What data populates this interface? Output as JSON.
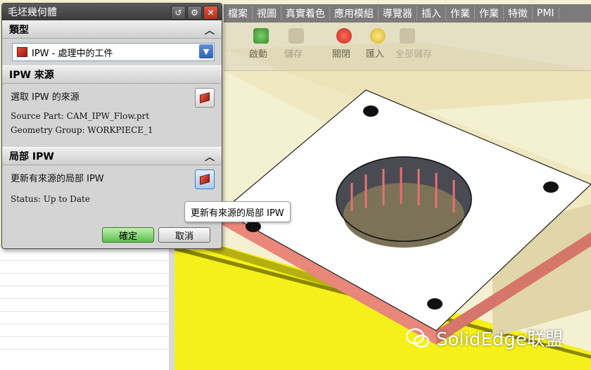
{
  "dialog": {
    "title": "毛坯幾何體",
    "sections": {
      "type": {
        "header": "類型",
        "selected": "IPW - 處理中的工件"
      },
      "source": {
        "header": "IPW 來源",
        "select_label": "選取 IPW 的來源",
        "source_part": "Source Part: CAM_IPW_Flow.prt",
        "geometry_group": "Geometry Group: WORKPIECE_1"
      },
      "local": {
        "header": "局部 IPW",
        "update_label": "更新有來源的局部 IPW",
        "status": "Status: Up to Date"
      }
    },
    "ok_label": "確定",
    "cancel_label": "取消"
  },
  "tooltip": "更新有來源的局部 IPW",
  "menubar": {
    "items": [
      "檔案",
      "視圖",
      "真實着色",
      "應用模組",
      "導覽器",
      "插入",
      "作業",
      "作業",
      "特徵",
      "PMI"
    ]
  },
  "toolbar": {
    "items": [
      "啟動",
      "儲存",
      "關閉",
      "匯入",
      "全部儲存"
    ]
  },
  "watermark": "SolidEdge联盟",
  "colors": {
    "model_face": "#ffffff",
    "model_side": "#e8877a",
    "fixture": "#f5f01a",
    "dialog_bg": "#d4d4d4",
    "ok_green": "#5cbf4c"
  }
}
